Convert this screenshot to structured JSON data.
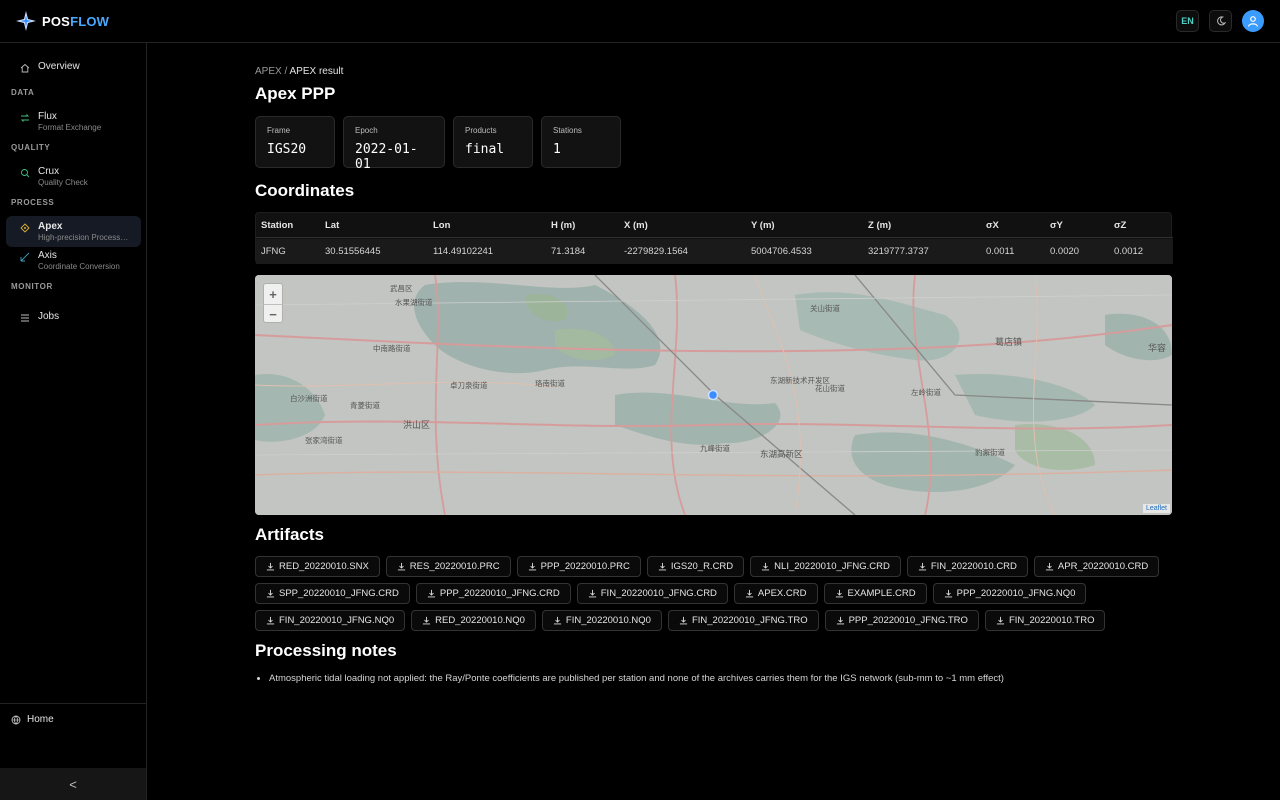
{
  "app": {
    "logo_pos": "POS",
    "logo_flow": "FLOW"
  },
  "topbar": {
    "lang": "EN",
    "theme_icon": "moon-icon",
    "user_icon": "user-icon"
  },
  "sidebar": {
    "overview": "Overview",
    "sections": {
      "data": "DATA",
      "quality": "QUALITY",
      "process": "PROCESS",
      "monitor": "MONITOR"
    },
    "items": [
      {
        "title": "Flux",
        "sub": "Format Exchange"
      },
      {
        "title": "Crux",
        "sub": "Quality Check"
      },
      {
        "title": "Apex",
        "sub": "High-precision Processing"
      },
      {
        "title": "Axis",
        "sub": "Coordinate Conversion"
      }
    ],
    "jobs": "Jobs",
    "home": "Home",
    "collapse": "<"
  },
  "breadcrumb": {
    "parent": "APEX",
    "sep": "/",
    "current": "APEX result"
  },
  "page_title": "Apex PPP",
  "stats": [
    {
      "label": "Frame",
      "value": "IGS20"
    },
    {
      "label": "Epoch",
      "value": "2022-01-01"
    },
    {
      "label": "Products",
      "value": "final"
    },
    {
      "label": "Stations",
      "value": "1"
    }
  ],
  "coordinates": {
    "title": "Coordinates",
    "headers": [
      "Station",
      "Lat",
      "Lon",
      "H (m)",
      "X (m)",
      "Y (m)",
      "Z (m)",
      "σX",
      "σY",
      "σZ"
    ],
    "rows": [
      [
        "JFNG",
        "30.51556445",
        "114.49102241",
        "71.3184",
        "-2279829.1564",
        "5004706.4533",
        "3219777.3737",
        "0.0011",
        "0.0020",
        "0.0012"
      ]
    ]
  },
  "map": {
    "zoom_in": "+",
    "zoom_out": "−",
    "attribution": "Leaflet",
    "labels": [
      "武昌区",
      "水果湖街道",
      "关山街道",
      "洪山区",
      "东湖新技术开发区",
      "左岭街道",
      "花山街道",
      "九峰街道",
      "东湖高新区",
      "豹澥街道",
      "葛店镇",
      "华容",
      "白沙洲街道",
      "青菱街道",
      "张家湾街道",
      "珞南街道",
      "卓刀泉街道",
      "中南路街道"
    ]
  },
  "artifacts": {
    "title": "Artifacts",
    "rows": [
      [
        "RED_20220010.SNX",
        "RES_20220010.PRC",
        "PPP_20220010.PRC",
        "IGS20_R.CRD",
        "NLI_20220010_JFNG.CRD",
        "FIN_20220010.CRD",
        "APR_20220010.CRD"
      ],
      [
        "SPP_20220010_JFNG.CRD",
        "PPP_20220010_JFNG.CRD",
        "FIN_20220010_JFNG.CRD",
        "APEX.CRD",
        "EXAMPLE.CRD",
        "PPP_20220010_JFNG.NQ0"
      ],
      [
        "FIN_20220010_JFNG.NQ0",
        "RED_20220010.NQ0",
        "FIN_20220010.NQ0",
        "FIN_20220010_JFNG.TRO",
        "PPP_20220010_JFNG.TRO",
        "FIN_20220010.TRO"
      ]
    ]
  },
  "notes": {
    "title": "Processing notes",
    "items": [
      "Atmospheric tidal loading not applied: the Ray/Ponte coefficients are published per station and none of the archives carries them for the IGS network (sub-mm to ~1 mm effect)"
    ]
  },
  "colors": {
    "accent": "#4aa8ff",
    "teal": "#4fd1c5",
    "background": "#000000",
    "card": "#121212"
  }
}
